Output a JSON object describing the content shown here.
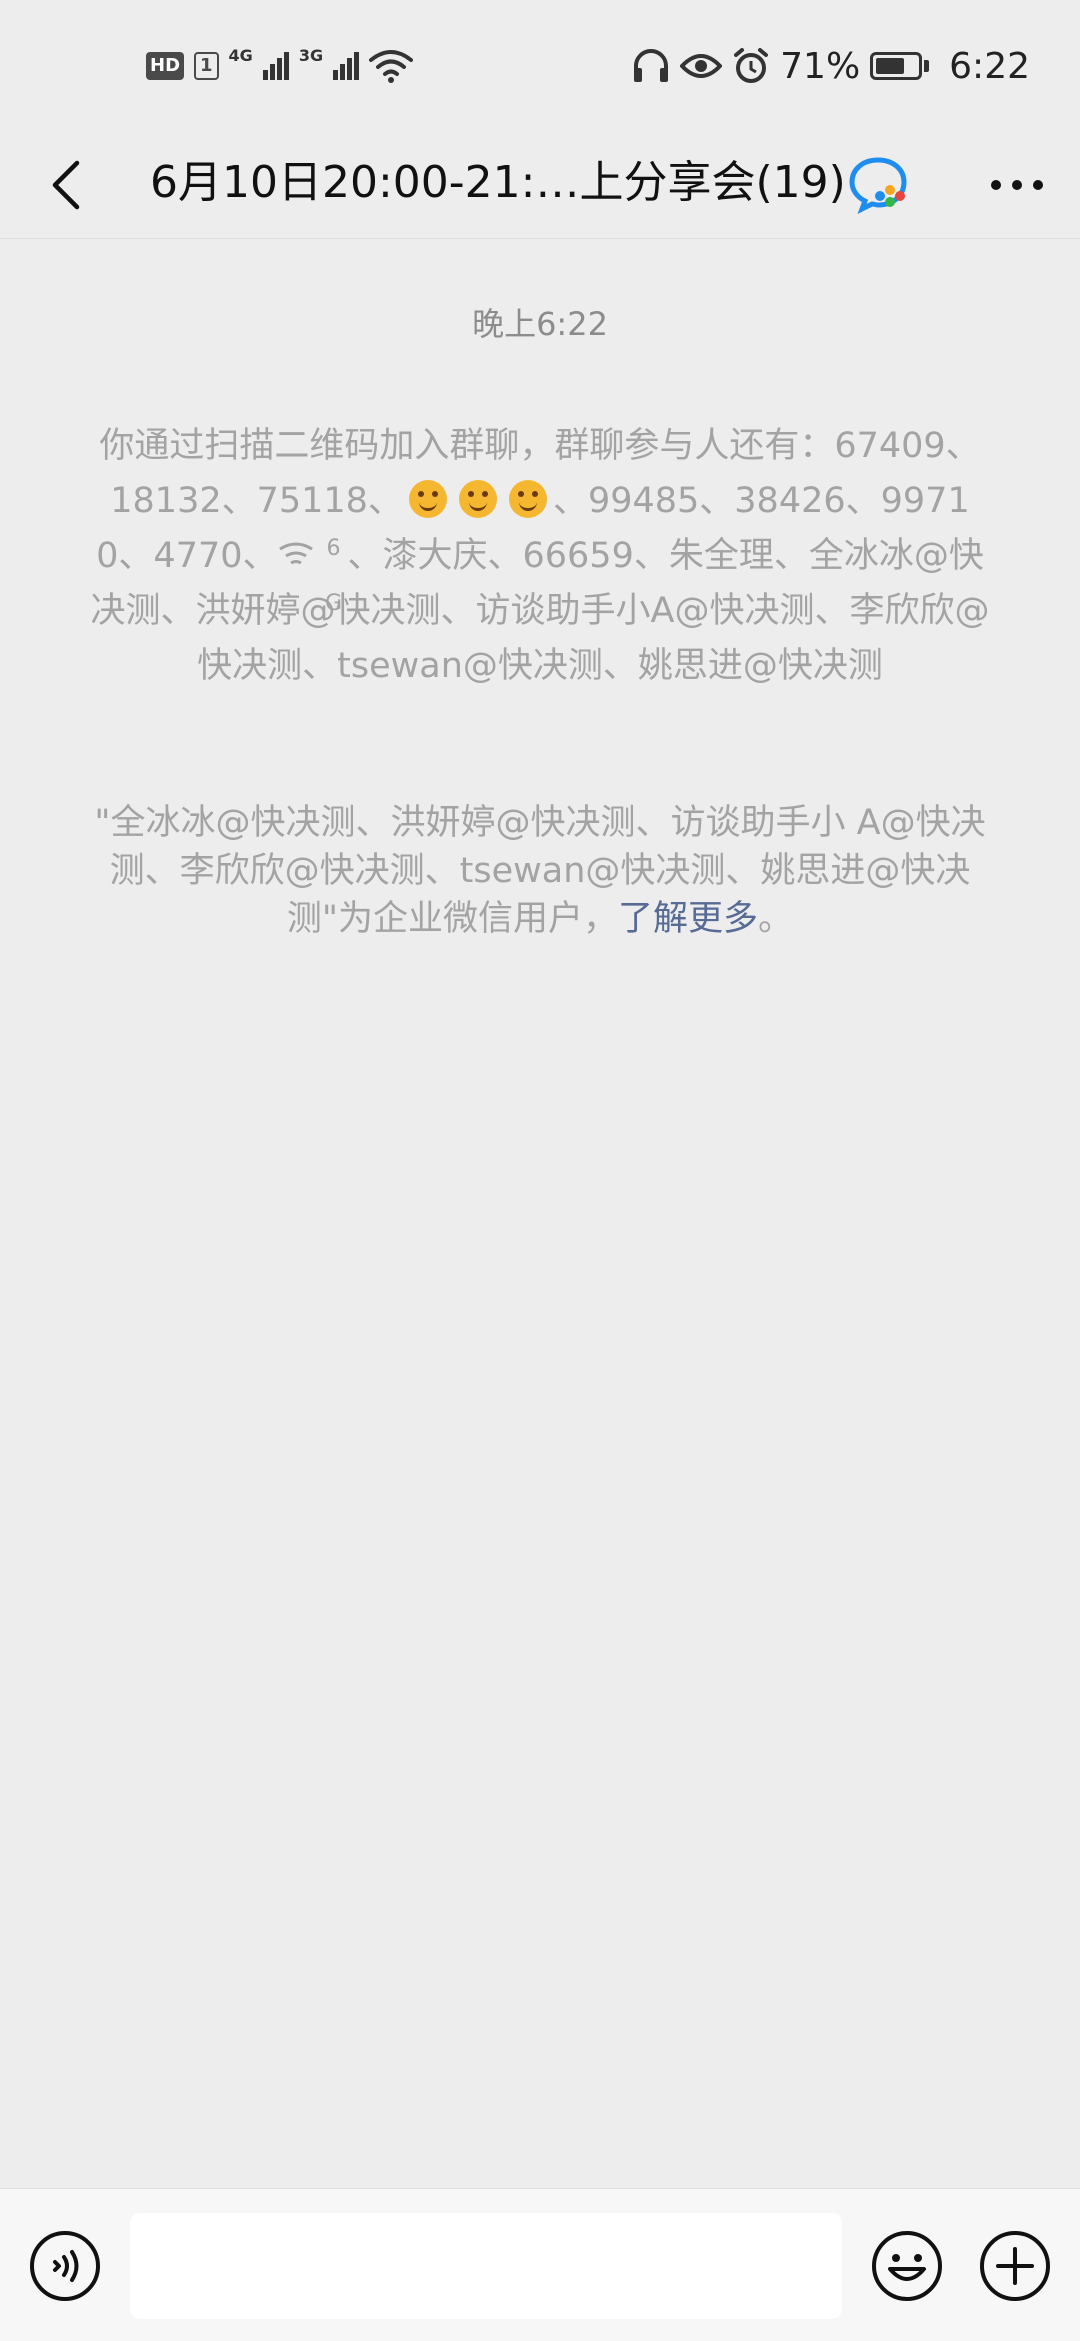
{
  "status_bar": {
    "hd_label": "HD",
    "sim_label": "1",
    "net1": "4G",
    "net2": "3G",
    "battery_percent": "71%",
    "battery_level": 0.71,
    "time": "6:22"
  },
  "header": {
    "title": "6月10日20:00-21:…上分享会(19)",
    "back_icon": "chevron-left-icon",
    "more_icon": "more-dots-icon",
    "group_icon": "wecom-group-icon"
  },
  "chat": {
    "timestamp": "晚上6:22",
    "join_msg": {
      "part1": "你通过扫描二维码加入群聊，群聊参与人还有：67409、18132、75118、",
      "part2": "、99485、38426、99710、4770、",
      "wifi_superscript": "6G",
      "part3": "、漆大庆、66659、朱全理、全冰冰@快决测、洪妍婷@快决测、访谈助手小A@快决测、李欣欣@快决测、tsewan@快决测、姚思进@快决测"
    },
    "corp_msg": {
      "text": "\"全冰冰@快决测、洪妍婷@快决测、访谈助手小 A@快决测、李欣欣@快决测、tsewan@快决测、姚思进@快决测\"为企业微信用户，",
      "link": "了解更多",
      "suffix": "。"
    }
  },
  "input_bar": {
    "voice_icon": "voice-icon",
    "input_value": "",
    "emoji_icon": "emoji-icon",
    "plus_icon": "plus-icon"
  }
}
